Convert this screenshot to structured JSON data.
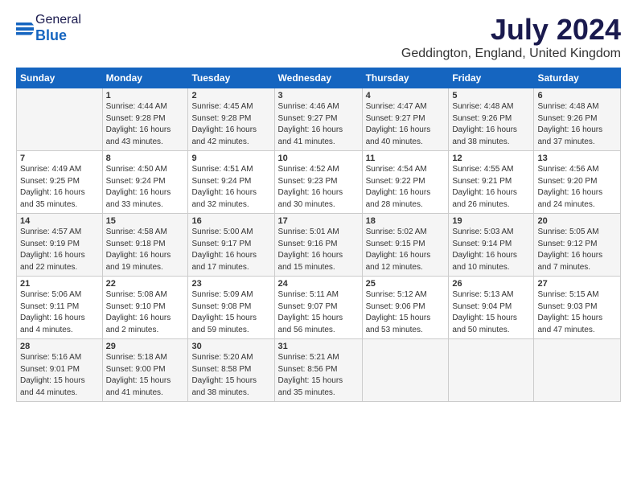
{
  "header": {
    "logo_general": "General",
    "logo_blue": "Blue",
    "title": "July 2024",
    "subtitle": "Geddington, England, United Kingdom"
  },
  "calendar": {
    "days_of_week": [
      "Sunday",
      "Monday",
      "Tuesday",
      "Wednesday",
      "Thursday",
      "Friday",
      "Saturday"
    ],
    "weeks": [
      [
        {
          "day": "",
          "info": ""
        },
        {
          "day": "1",
          "info": "Sunrise: 4:44 AM\nSunset: 9:28 PM\nDaylight: 16 hours\nand 43 minutes."
        },
        {
          "day": "2",
          "info": "Sunrise: 4:45 AM\nSunset: 9:28 PM\nDaylight: 16 hours\nand 42 minutes."
        },
        {
          "day": "3",
          "info": "Sunrise: 4:46 AM\nSunset: 9:27 PM\nDaylight: 16 hours\nand 41 minutes."
        },
        {
          "day": "4",
          "info": "Sunrise: 4:47 AM\nSunset: 9:27 PM\nDaylight: 16 hours\nand 40 minutes."
        },
        {
          "day": "5",
          "info": "Sunrise: 4:48 AM\nSunset: 9:26 PM\nDaylight: 16 hours\nand 38 minutes."
        },
        {
          "day": "6",
          "info": "Sunrise: 4:48 AM\nSunset: 9:26 PM\nDaylight: 16 hours\nand 37 minutes."
        }
      ],
      [
        {
          "day": "7",
          "info": "Sunrise: 4:49 AM\nSunset: 9:25 PM\nDaylight: 16 hours\nand 35 minutes."
        },
        {
          "day": "8",
          "info": "Sunrise: 4:50 AM\nSunset: 9:24 PM\nDaylight: 16 hours\nand 33 minutes."
        },
        {
          "day": "9",
          "info": "Sunrise: 4:51 AM\nSunset: 9:24 PM\nDaylight: 16 hours\nand 32 minutes."
        },
        {
          "day": "10",
          "info": "Sunrise: 4:52 AM\nSunset: 9:23 PM\nDaylight: 16 hours\nand 30 minutes."
        },
        {
          "day": "11",
          "info": "Sunrise: 4:54 AM\nSunset: 9:22 PM\nDaylight: 16 hours\nand 28 minutes."
        },
        {
          "day": "12",
          "info": "Sunrise: 4:55 AM\nSunset: 9:21 PM\nDaylight: 16 hours\nand 26 minutes."
        },
        {
          "day": "13",
          "info": "Sunrise: 4:56 AM\nSunset: 9:20 PM\nDaylight: 16 hours\nand 24 minutes."
        }
      ],
      [
        {
          "day": "14",
          "info": "Sunrise: 4:57 AM\nSunset: 9:19 PM\nDaylight: 16 hours\nand 22 minutes."
        },
        {
          "day": "15",
          "info": "Sunrise: 4:58 AM\nSunset: 9:18 PM\nDaylight: 16 hours\nand 19 minutes."
        },
        {
          "day": "16",
          "info": "Sunrise: 5:00 AM\nSunset: 9:17 PM\nDaylight: 16 hours\nand 17 minutes."
        },
        {
          "day": "17",
          "info": "Sunrise: 5:01 AM\nSunset: 9:16 PM\nDaylight: 16 hours\nand 15 minutes."
        },
        {
          "day": "18",
          "info": "Sunrise: 5:02 AM\nSunset: 9:15 PM\nDaylight: 16 hours\nand 12 minutes."
        },
        {
          "day": "19",
          "info": "Sunrise: 5:03 AM\nSunset: 9:14 PM\nDaylight: 16 hours\nand 10 minutes."
        },
        {
          "day": "20",
          "info": "Sunrise: 5:05 AM\nSunset: 9:12 PM\nDaylight: 16 hours\nand 7 minutes."
        }
      ],
      [
        {
          "day": "21",
          "info": "Sunrise: 5:06 AM\nSunset: 9:11 PM\nDaylight: 16 hours\nand 4 minutes."
        },
        {
          "day": "22",
          "info": "Sunrise: 5:08 AM\nSunset: 9:10 PM\nDaylight: 16 hours\nand 2 minutes."
        },
        {
          "day": "23",
          "info": "Sunrise: 5:09 AM\nSunset: 9:08 PM\nDaylight: 15 hours\nand 59 minutes."
        },
        {
          "day": "24",
          "info": "Sunrise: 5:11 AM\nSunset: 9:07 PM\nDaylight: 15 hours\nand 56 minutes."
        },
        {
          "day": "25",
          "info": "Sunrise: 5:12 AM\nSunset: 9:06 PM\nDaylight: 15 hours\nand 53 minutes."
        },
        {
          "day": "26",
          "info": "Sunrise: 5:13 AM\nSunset: 9:04 PM\nDaylight: 15 hours\nand 50 minutes."
        },
        {
          "day": "27",
          "info": "Sunrise: 5:15 AM\nSunset: 9:03 PM\nDaylight: 15 hours\nand 47 minutes."
        }
      ],
      [
        {
          "day": "28",
          "info": "Sunrise: 5:16 AM\nSunset: 9:01 PM\nDaylight: 15 hours\nand 44 minutes."
        },
        {
          "day": "29",
          "info": "Sunrise: 5:18 AM\nSunset: 9:00 PM\nDaylight: 15 hours\nand 41 minutes."
        },
        {
          "day": "30",
          "info": "Sunrise: 5:20 AM\nSunset: 8:58 PM\nDaylight: 15 hours\nand 38 minutes."
        },
        {
          "day": "31",
          "info": "Sunrise: 5:21 AM\nSunset: 8:56 PM\nDaylight: 15 hours\nand 35 minutes."
        },
        {
          "day": "",
          "info": ""
        },
        {
          "day": "",
          "info": ""
        },
        {
          "day": "",
          "info": ""
        }
      ]
    ]
  }
}
